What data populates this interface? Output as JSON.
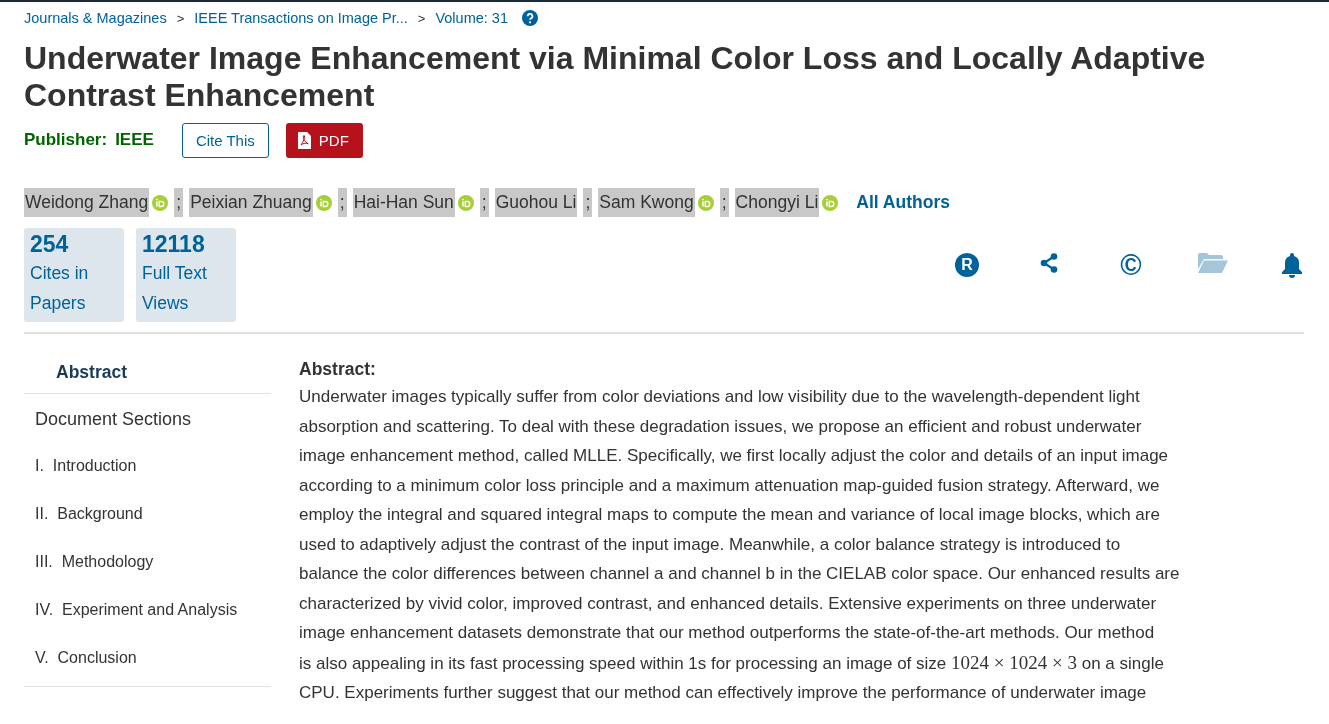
{
  "breadcrumbs": [
    "Journals & Magazines",
    "IEEE Transactions on Image Pr...",
    "Volume: 31"
  ],
  "breadcrumb_separator": ">",
  "title": "Underwater Image Enhancement via Minimal Color Loss and Locally Adaptive Contrast Enhancement",
  "publisher": {
    "label": "Publisher:",
    "value": "IEEE"
  },
  "buttons": [
    {
      "kind": "outline",
      "label": "Cite This"
    },
    {
      "kind": "pdf",
      "label": "PDF"
    }
  ],
  "authors": [
    {
      "name": "Weidong Zhang",
      "orcid": true
    },
    {
      "name": "Peixian Zhuang",
      "orcid": true
    },
    {
      "name": "Hai-Han Sun",
      "orcid": true
    },
    {
      "name": "Guohou Li",
      "orcid": false
    },
    {
      "name": "Sam Kwong",
      "orcid": true
    },
    {
      "name": "Chongyi Li",
      "orcid": true
    }
  ],
  "author_separator": ";",
  "all_authors": "All Authors",
  "metrics": [
    {
      "value": "254",
      "label": "Cites in Papers"
    },
    {
      "value": "12118",
      "label": "Full Text Views"
    }
  ],
  "tools": [
    {
      "kind": "r-badge",
      "glyph": "R",
      "disabled": false
    },
    {
      "kind": "share",
      "disabled": false
    },
    {
      "kind": "copyright",
      "glyph": "©",
      "disabled": false
    },
    {
      "kind": "folder",
      "disabled": true
    },
    {
      "kind": "bell",
      "disabled": false
    }
  ],
  "nav": {
    "abstract": "Abstract",
    "heading": "Document Sections",
    "items": [
      {
        "num": "I.",
        "label": "Introduction"
      },
      {
        "num": "II.",
        "label": "Background"
      },
      {
        "num": "III.",
        "label": "Methodology"
      },
      {
        "num": "IV.",
        "label": "Experiment and Analysis"
      },
      {
        "num": "V.",
        "label": "Conclusion"
      }
    ]
  },
  "abstract": {
    "heading": "Abstract:",
    "lines": [
      [
        {
          "kind": "text",
          "text": "Underwater images typically suffer from color deviations and low visibility due to the wavelength-dependent light"
        }
      ],
      [
        {
          "kind": "text",
          "text": "absorption and scattering. To deal with these degradation issues, we propose an efficient and robust underwater"
        }
      ],
      [
        {
          "kind": "text",
          "text": "image enhancement method, called MLLE. Specifically, we first locally adjust the color and details of an input image"
        }
      ],
      [
        {
          "kind": "text",
          "text": "according to a minimum color loss principle and a maximum attenuation map-guided fusion strategy. Afterward, we"
        }
      ],
      [
        {
          "kind": "text",
          "text": "employ the integral and squared integral maps to compute the mean and variance of local image blocks, which are"
        }
      ],
      [
        {
          "kind": "text",
          "text": "used to adaptively adjust the contrast of the input image. Meanwhile, a color balance strategy is introduced to"
        }
      ],
      [
        {
          "kind": "text",
          "text": "balance the color differences between channel a and channel b in the CIELAB color space. Our enhanced results are"
        }
      ],
      [
        {
          "kind": "text",
          "text": "characterized by vivid color, improved contrast, and enhanced details. Extensive experiments on three underwater"
        }
      ],
      [
        {
          "kind": "text",
          "text": "image enhancement datasets demonstrate that our method outperforms the state-of-the-art methods. Our method"
        }
      ],
      [
        {
          "kind": "text",
          "text": "is also appealing in its fast processing speed within 1s for processing an image of size "
        },
        {
          "kind": "math",
          "text": "1024 × 1024 × 3"
        },
        {
          "kind": "text",
          "text": " on a single"
        }
      ],
      [
        {
          "kind": "text",
          "text": "CPU. Experiments further suggest that our method can effectively improve the performance of underwater image"
        }
      ]
    ]
  }
}
